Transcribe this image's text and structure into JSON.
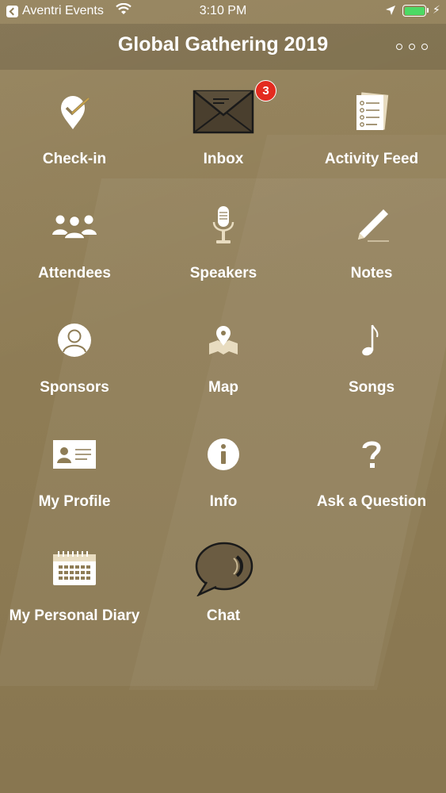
{
  "status_bar": {
    "app_name": "Aventri Events",
    "time": "3:10 PM",
    "battery_color": "#4cd964"
  },
  "header": {
    "title": "Global Gathering 2019",
    "more_icon": "ellipsis-circles-icon"
  },
  "inbox_badge": "3",
  "tiles": [
    {
      "label": "Check-in",
      "icon": "check-in-pin-icon"
    },
    {
      "label": "Inbox",
      "icon": "envelope-icon"
    },
    {
      "label": "Activity Feed",
      "icon": "feed-list-icon"
    },
    {
      "label": "Attendees",
      "icon": "people-group-icon"
    },
    {
      "label": "Speakers",
      "icon": "microphone-icon"
    },
    {
      "label": "Notes",
      "icon": "pen-icon"
    },
    {
      "label": "Sponsors",
      "icon": "person-circle-icon"
    },
    {
      "label": "Map",
      "icon": "map-pin-icon"
    },
    {
      "label": "Songs",
      "icon": "music-note-icon"
    },
    {
      "label": "My Profile",
      "icon": "id-card-icon"
    },
    {
      "label": "Info",
      "icon": "info-icon"
    },
    {
      "label": "Ask a Question",
      "icon": "question-mark-icon"
    },
    {
      "label": "My Personal Diary",
      "icon": "calendar-icon"
    },
    {
      "label": "Chat",
      "icon": "chat-bubble-icon"
    }
  ]
}
